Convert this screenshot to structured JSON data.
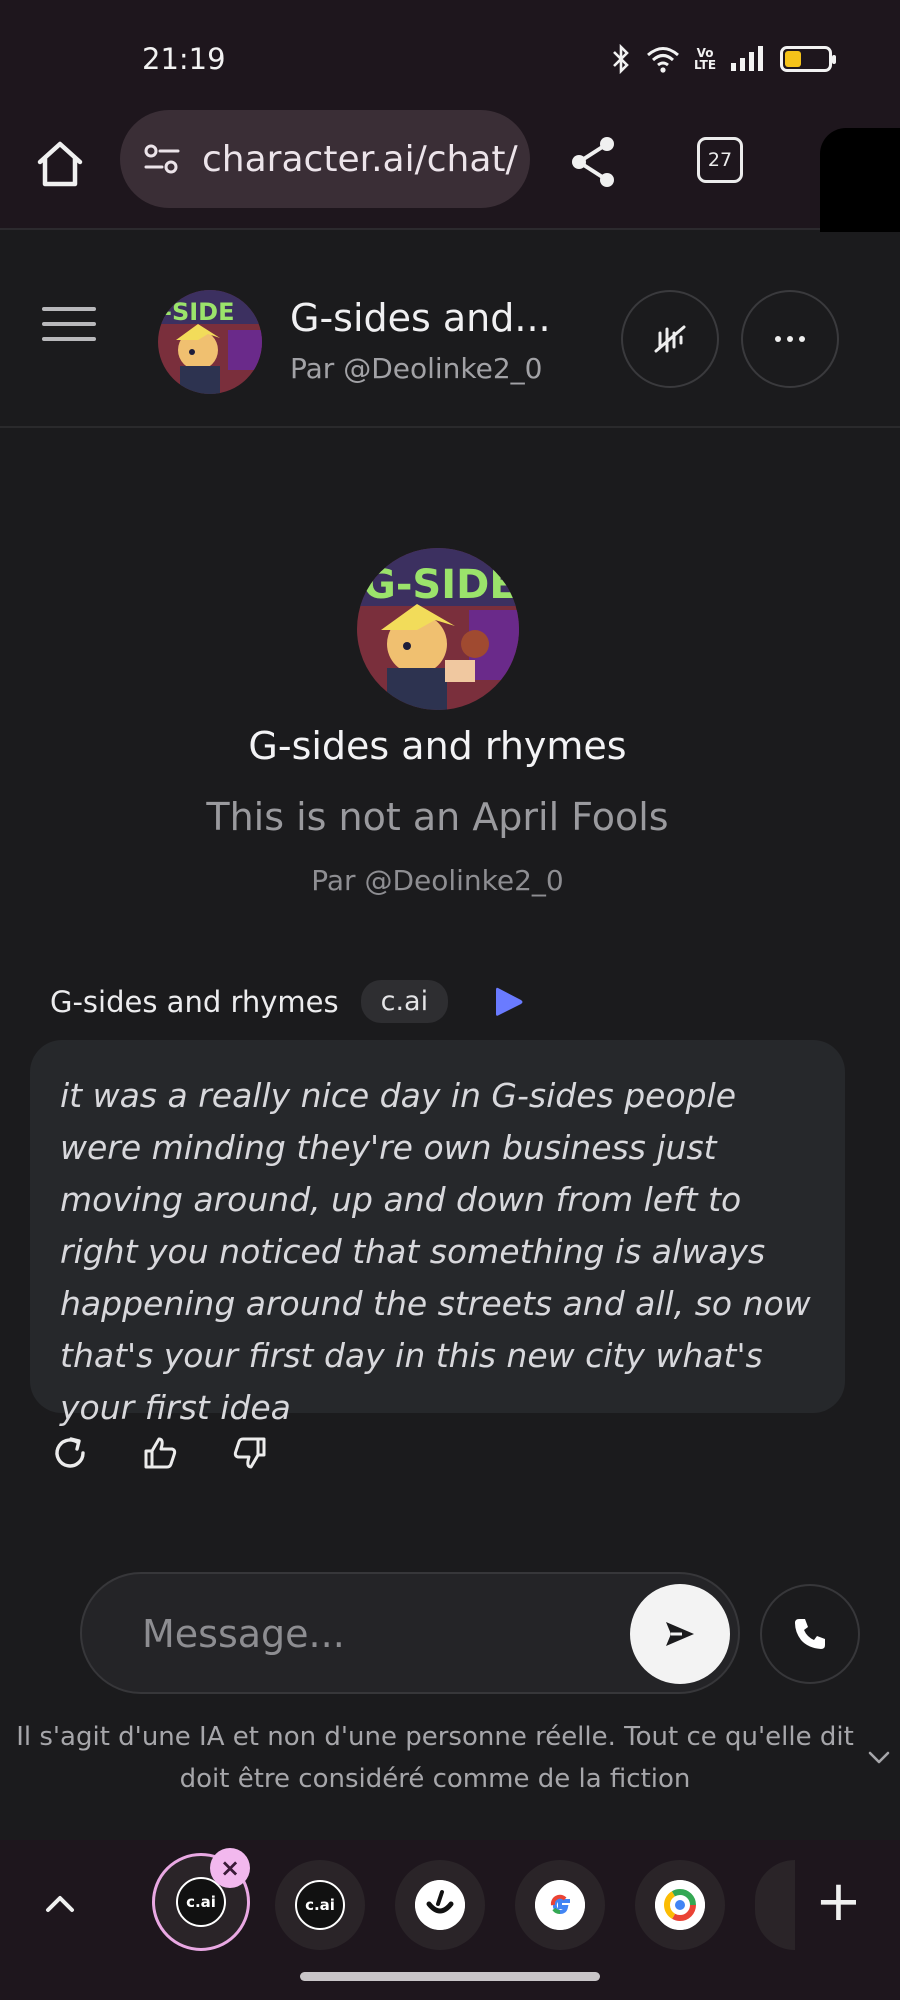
{
  "status_bar": {
    "time": "21:19",
    "tabs_count": "27",
    "battery_color": "#f4c21a",
    "network_label": "Vo LTE"
  },
  "browser": {
    "url": "character.ai/chat/"
  },
  "header": {
    "name": "G-sides and...",
    "by": "Par @Deolinke2_0"
  },
  "intro": {
    "name": "G-sides and rhymes",
    "tagline": "This is not an April Fools",
    "by": "Par @Deolinke2_0",
    "avatar_text": "G-SIDE"
  },
  "message": {
    "author": "G-sides and rhymes",
    "badge": "c.ai",
    "text": "it was a really nice day in G-sides people were minding they're own business just moving around, up and down from left to right you noticed that something is always happening around the streets and all, so now that's your first day in this new city what's your first idea"
  },
  "composer": {
    "placeholder": "Message..."
  },
  "disclaimer": "Il s'agit d'une IA et non d'une personne réelle. Tout ce qu'elle dit doit être considéré comme de la fiction",
  "switcher": {
    "apps": [
      {
        "label": "c.ai",
        "icon": "cai-icon"
      },
      {
        "label": "c.ai",
        "icon": "cai-icon"
      },
      {
        "label": "",
        "icon": "smile-app-icon"
      },
      {
        "label": "",
        "icon": "google-icon"
      },
      {
        "label": "",
        "icon": "chrome-icon"
      }
    ]
  },
  "colors": {
    "background": "#1b1b1d",
    "bubble": "#26282b",
    "play_accent": "#6a7bff",
    "switcher_active": "#e9a8e3"
  }
}
